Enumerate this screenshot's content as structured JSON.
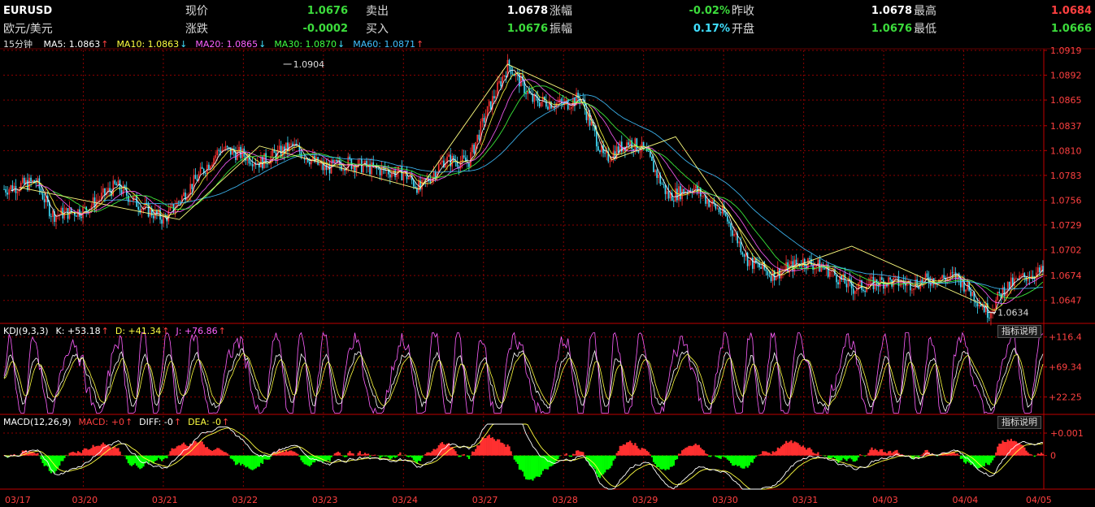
{
  "header": {
    "symbol": "EURUSD",
    "name": "欧元/美元",
    "row1": [
      {
        "label": "现价",
        "value": "1.0676",
        "color": "#3cdc3c"
      },
      {
        "label": "卖出",
        "value": "1.0678",
        "color": "#ffffff"
      },
      {
        "label": "涨幅",
        "value": "-0.02%",
        "color": "#3cdc3c"
      },
      {
        "label": "昨收",
        "value": "1.0678",
        "color": "#ffffff"
      },
      {
        "label": "最高",
        "value": "1.0684",
        "color": "#ff4040"
      }
    ],
    "row2": [
      {
        "label": "涨跌",
        "value": "-0.0002",
        "color": "#3cdc3c"
      },
      {
        "label": "买入",
        "value": "1.0676",
        "color": "#3cdc3c"
      },
      {
        "label": "振幅",
        "value": "0.17%",
        "color": "#40e0ff"
      },
      {
        "label": "开盘",
        "value": "1.0676",
        "color": "#3cdc3c"
      },
      {
        "label": "最低",
        "value": "1.0666",
        "color": "#3cdc3c"
      }
    ]
  },
  "ma_bar": {
    "period": "15分钟",
    "items": [
      {
        "text": "MA5: 1.0863",
        "arrow": "↑",
        "color": "#ffffff",
        "arrow_color": "#ff4040"
      },
      {
        "text": "MA10: 1.0863",
        "arrow": "↓",
        "color": "#ffff40",
        "arrow_color": "#40e0ff"
      },
      {
        "text": "MA20: 1.0865",
        "arrow": "↓",
        "color": "#ff60ff",
        "arrow_color": "#40e0ff"
      },
      {
        "text": "MA30: 1.0870",
        "arrow": "↓",
        "color": "#40ff40",
        "arrow_color": "#40e0ff"
      },
      {
        "text": "MA60: 1.0871",
        "arrow": "↑",
        "color": "#40c0ff",
        "arrow_color": "#ff4040"
      }
    ]
  },
  "kdj_bar": {
    "items": [
      {
        "text": "KDJ(9,3,3)",
        "color": "#ffffff",
        "arrow": ""
      },
      {
        "text": "K: +53.18",
        "color": "#ffffff",
        "arrow": "↑"
      },
      {
        "text": "D: +41.34",
        "color": "#ffff40",
        "arrow": "↑"
      },
      {
        "text": "J: +76.86",
        "color": "#ff60ff",
        "arrow": "↑"
      }
    ],
    "button": "指标说明"
  },
  "macd_bar": {
    "items": [
      {
        "text": "MACD(12,26,9)",
        "color": "#ffffff",
        "arrow": ""
      },
      {
        "text": "MACD: +0",
        "color": "#ff4040",
        "arrow": "↑"
      },
      {
        "text": "DIFF: -0",
        "color": "#ffffff",
        "arrow": "↑"
      },
      {
        "text": "DEA: -0",
        "color": "#ffff40",
        "arrow": "↑"
      }
    ],
    "button": "指标说明"
  },
  "chart_data": {
    "type": "line",
    "x_ticks": [
      "03/17",
      "03/20",
      "03/21",
      "03/22",
      "03/23",
      "03/24",
      "03/27",
      "03/28",
      "03/29",
      "03/30",
      "03/31",
      "04/03",
      "04/04",
      "04/05"
    ],
    "price_axis": {
      "ylim": [
        1.0622,
        1.0919
      ],
      "ticks": [
        "1.0919",
        "1.0892",
        "1.0865",
        "1.0837",
        "1.0810",
        "1.0783",
        "1.0756",
        "1.0729",
        "1.0702",
        "1.0674",
        "1.0647"
      ]
    },
    "price_annotations": [
      {
        "text": "1.0904",
        "value": 1.0904,
        "at": 3.5
      },
      {
        "text": "1.0634",
        "value": 1.0634,
        "at": 12.3
      }
    ],
    "price_keypoints": [
      [
        0,
        1.0768
      ],
      [
        0.4,
        1.0776
      ],
      [
        0.6,
        1.074
      ],
      [
        1.0,
        1.0745
      ],
      [
        1.4,
        1.0772
      ],
      [
        1.7,
        1.075
      ],
      [
        2.0,
        1.0735
      ],
      [
        2.3,
        1.0768
      ],
      [
        2.7,
        1.0812
      ],
      [
        3.0,
        1.0805
      ],
      [
        3.2,
        1.0797
      ],
      [
        3.6,
        1.0815
      ],
      [
        4.0,
        1.079
      ],
      [
        4.3,
        1.0797
      ],
      [
        4.6,
        1.079
      ],
      [
        5.0,
        1.0785
      ],
      [
        5.2,
        1.0768
      ],
      [
        5.5,
        1.08
      ],
      [
        5.8,
        1.0797
      ],
      [
        6.0,
        1.0845
      ],
      [
        6.3,
        1.0904
      ],
      [
        6.6,
        1.0865
      ],
      [
        7.0,
        1.086
      ],
      [
        7.2,
        1.0868
      ],
      [
        7.5,
        1.08
      ],
      [
        7.8,
        1.082
      ],
      [
        8.0,
        1.081
      ],
      [
        8.3,
        1.076
      ],
      [
        8.6,
        1.077
      ],
      [
        9.0,
        1.074
      ],
      [
        9.3,
        1.069
      ],
      [
        9.6,
        1.0675
      ],
      [
        10.0,
        1.069
      ],
      [
        10.3,
        1.068
      ],
      [
        10.6,
        1.066
      ],
      [
        11.0,
        1.0668
      ],
      [
        11.3,
        1.0665
      ],
      [
        11.6,
        1.067
      ],
      [
        11.9,
        1.0673
      ],
      [
        12.0,
        1.0664
      ],
      [
        12.3,
        1.0634
      ],
      [
        12.5,
        1.066
      ],
      [
        12.8,
        1.0675
      ],
      [
        13.0,
        1.0678
      ]
    ],
    "kdj_axis": {
      "ticks": [
        "+116.4",
        "+69.34",
        "+22.25"
      ],
      "ylim": [
        -5,
        125
      ]
    },
    "macd_axis": {
      "ticks": [
        "+0.001",
        "0"
      ],
      "ylim": [
        -0.0015,
        0.0014
      ]
    },
    "series": [
      {
        "name": "MA5",
        "color": "#ffffff"
      },
      {
        "name": "MA10",
        "color": "#ffff40"
      },
      {
        "name": "MA20",
        "color": "#ff60ff"
      },
      {
        "name": "MA30",
        "color": "#40ff40"
      },
      {
        "name": "MA60",
        "color": "#40c0ff"
      }
    ],
    "colors": {
      "up": "#ff3030",
      "down": "#00ff00",
      "grid": "#8b0000",
      "axis": "#c00000"
    }
  }
}
